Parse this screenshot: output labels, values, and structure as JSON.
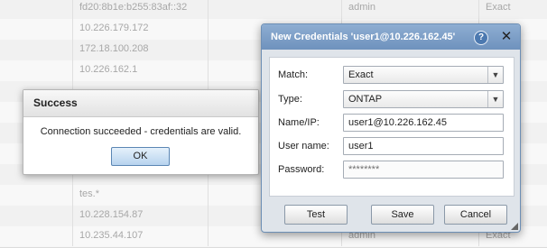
{
  "background_table": {
    "rows": [
      {
        "col1": "fd20:8b1e:b255:83af::32",
        "col2": "admin",
        "col3": "Exact"
      },
      {
        "col1": "10.226.179.172",
        "col2": "",
        "col3": ""
      },
      {
        "col1": "172.18.100.208",
        "col2": "",
        "col3": ""
      },
      {
        "col1": "10.226.162.1",
        "col2": "",
        "col3": ""
      },
      {
        "col1": "",
        "col2": "",
        "col3": ""
      },
      {
        "col1": "",
        "col2": "",
        "col3": ""
      },
      {
        "col1": "",
        "col2": "",
        "col3": ""
      },
      {
        "col1": "",
        "col2": "",
        "col3": ""
      },
      {
        "col1": "",
        "col2": "",
        "col3": ""
      },
      {
        "col1": "tes.*",
        "col2": "",
        "col3": ""
      },
      {
        "col1": "10.228.154.87",
        "col2": "",
        "col3": ""
      },
      {
        "col1": "10.235.44.107",
        "col2": "admin",
        "col3": "Exact"
      }
    ]
  },
  "success_dialog": {
    "title": "Success",
    "message": "Connection succeeded - credentials are valid.",
    "ok_label": "OK"
  },
  "credentials_dialog": {
    "title": "New Credentials 'user1@10.226.162.45'",
    "help_icon": "?",
    "close_icon": "✕",
    "fields": {
      "match": {
        "label": "Match:",
        "value": "Exact"
      },
      "type": {
        "label": "Type:",
        "value": "ONTAP"
      },
      "name_ip": {
        "label": "Name/IP:",
        "value": "user1@10.226.162.45"
      },
      "user_name": {
        "label": "User name:",
        "value": "user1"
      },
      "password": {
        "label": "Password:",
        "value": "********"
      }
    },
    "buttons": {
      "test": "Test",
      "save": "Save",
      "cancel": "Cancel"
    }
  }
}
